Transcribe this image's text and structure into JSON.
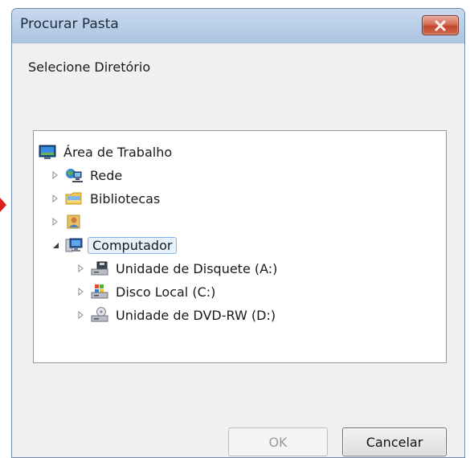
{
  "window": {
    "title": "Procurar Pasta",
    "close_icon": "close-icon"
  },
  "dialog": {
    "description": "Selecione Diretório"
  },
  "tree": {
    "nodes": [
      {
        "label": "Área de Trabalho",
        "icon": "desktop-icon",
        "expander": "none"
      },
      {
        "label": "Rede",
        "icon": "network-icon",
        "expander": "collapsed"
      },
      {
        "label": "Bibliotecas",
        "icon": "libraries-icon",
        "expander": "collapsed"
      },
      {
        "label": "",
        "icon": "user-folder-icon",
        "expander": "collapsed"
      },
      {
        "label": "Computador",
        "icon": "computer-icon",
        "expander": "expanded",
        "selected": true
      },
      {
        "label": "Unidade de Disquete (A:)",
        "icon": "floppy-drive-icon",
        "expander": "collapsed"
      },
      {
        "label": "Disco Local (C:)",
        "icon": "local-disk-icon",
        "expander": "collapsed"
      },
      {
        "label": "Unidade de DVD-RW (D:)",
        "icon": "dvd-drive-icon",
        "expander": "collapsed"
      }
    ]
  },
  "buttons": {
    "ok_label": "OK",
    "ok_enabled": false,
    "cancel_label": "Cancelar"
  },
  "colors": {
    "titlebar": "#b7cde7",
    "close_button": "#c2472d",
    "selection_fill": "#e5f1fb",
    "selection_border": "#7eb4ea",
    "annotation_arrow": "#d9221c"
  }
}
